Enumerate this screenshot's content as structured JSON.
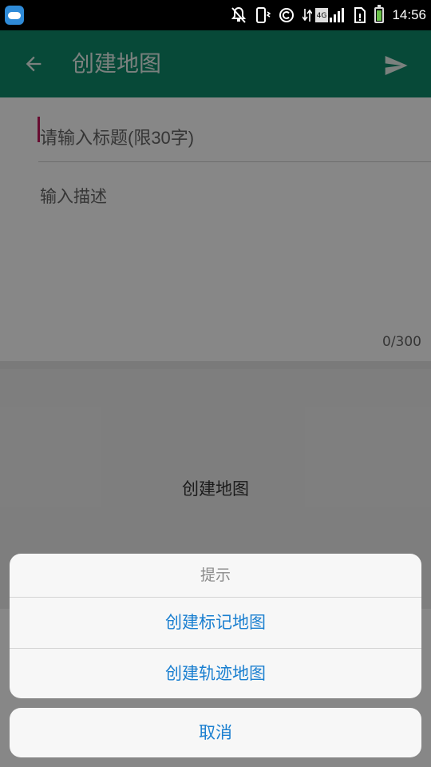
{
  "status_bar": {
    "time": "14:56",
    "network_label": "4G",
    "icons": [
      "cloud-app-icon",
      "notifications-muted-icon",
      "vibrate-icon",
      "copyright-c-icon",
      "data-arrows-icon",
      "signal-4g-icon",
      "sim-alert-icon",
      "battery-icon"
    ]
  },
  "app_bar": {
    "title": "创建地图",
    "back_icon": "arrow-left-icon",
    "send_icon": "send-icon",
    "color": "#0f8a6a"
  },
  "form": {
    "title_placeholder": "请输入标题(限30字)",
    "title_value": "",
    "description_placeholder": "输入描述",
    "description_value": "",
    "char_counter": "0/300"
  },
  "create_map_button": "创建地图",
  "action_sheet": {
    "title": "提示",
    "options": [
      "创建标记地图",
      "创建轨迹地图"
    ],
    "cancel": "取消",
    "option_color": "#1a7fd0"
  }
}
